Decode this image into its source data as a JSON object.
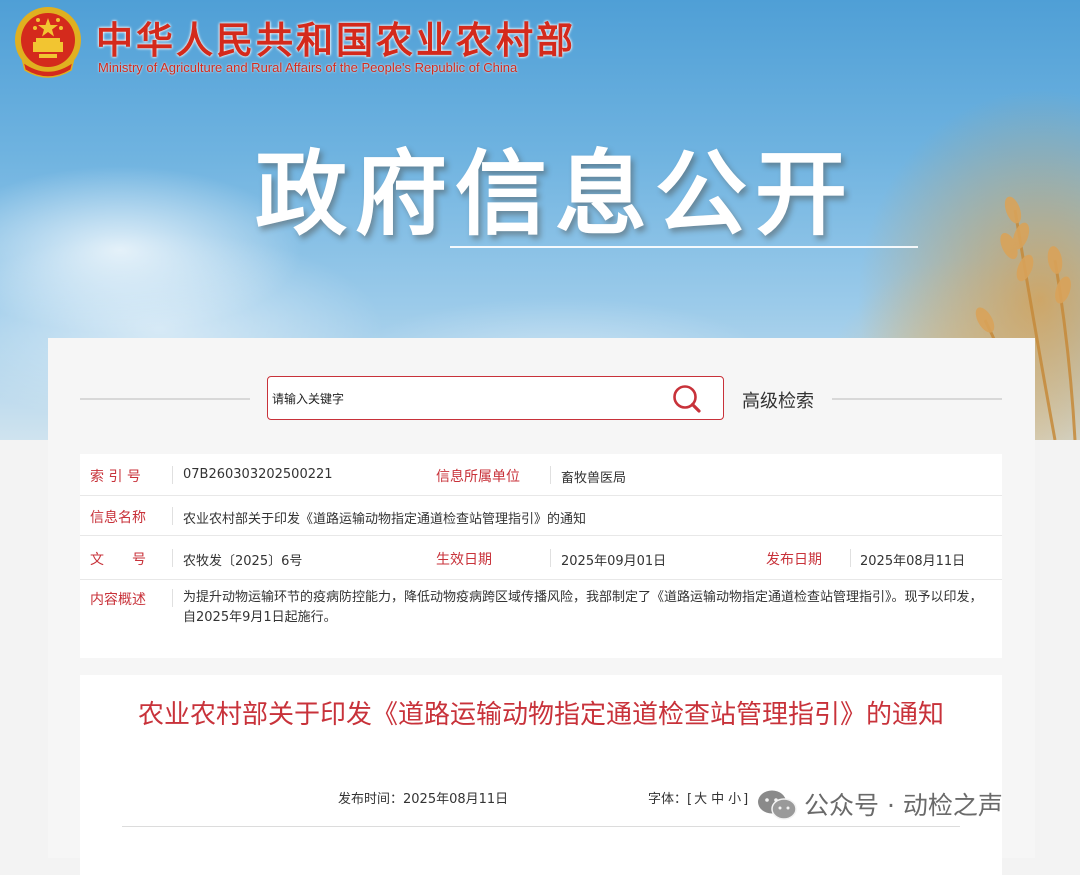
{
  "header": {
    "title_cn": "中华人民共和国农业农村部",
    "title_en": "Ministry of Agriculture and Rural Affairs of the People's Republic of China",
    "hero": "政府信息公开"
  },
  "search": {
    "placeholder": "请输入关键字",
    "advanced_label": "高级检索"
  },
  "info": {
    "index_label": "索 引 号",
    "index_value": "07B260303202500221",
    "unit_label": "信息所属单位",
    "unit_value": "畜牧兽医局",
    "name_label": "信息名称",
    "name_value": "农业农村部关于印发《道路运输动物指定通道检查站管理指引》的通知",
    "doc_label": "文　　号",
    "doc_value": "农牧发〔2025〕6号",
    "effective_label": "生效日期",
    "effective_value": "2025年09月01日",
    "publish_label": "发布日期",
    "publish_value": "2025年08月11日",
    "summary_label": "内容概述",
    "summary_value": "为提升动物运输环节的疫病防控能力，降低动物疫病跨区域传播风险，我部制定了《道路运输动物指定通道检查站管理指引》。现予以印发，自2025年9月1日起施行。"
  },
  "article": {
    "title": "农业农村部关于印发《道路运输动物指定通道检查站管理指引》的通知",
    "publish_time_label": "发布时间：",
    "publish_time_value": "2025年08月11日",
    "font_label": "字体：",
    "font_open": "[",
    "font_large": "大",
    "font_medium": "中",
    "font_small": "小",
    "font_close": "]"
  },
  "watermark": {
    "text": "公众号 · 动检之声"
  },
  "colors": {
    "accent_red": "#c8323a",
    "title_red": "#d42a1c"
  }
}
